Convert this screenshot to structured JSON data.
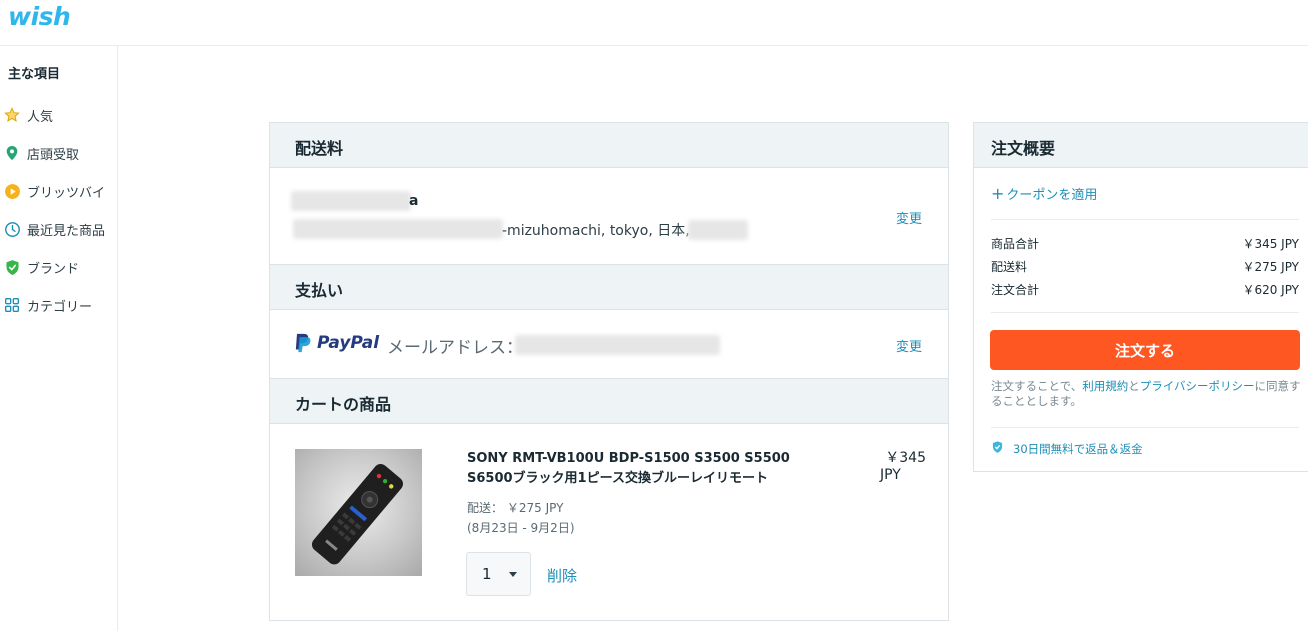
{
  "brand": {
    "logo_text": "wish"
  },
  "sidebar": {
    "heading": "主な項目",
    "items": [
      {
        "label": "人気",
        "icon": "star-icon"
      },
      {
        "label": "店頭受取",
        "icon": "location-pin-icon"
      },
      {
        "label": "ブリッツバイ",
        "icon": "play-circle-icon"
      },
      {
        "label": "最近見た商品",
        "icon": "clock-icon"
      },
      {
        "label": "ブランド",
        "icon": "shield-check-icon"
      },
      {
        "label": "カテゴリー",
        "icon": "grid-icon"
      }
    ]
  },
  "shipping": {
    "title": "配送料",
    "name_visible": "a",
    "address_visible": "-mizuhomachi, tokyo, 日本,",
    "change_label": "変更"
  },
  "payment": {
    "title": "支払い",
    "paypal_brand": "PayPal",
    "email_label": "メールアドレス：",
    "change_label": "変更"
  },
  "cart": {
    "title": "カートの商品",
    "product": {
      "name": "SONY RMT-VB100U BDP-S1500 S3500 S5500 S6500ブラック用1ピース交換ブルーレイリモート",
      "price": "￥345",
      "currency": "JPY",
      "shipping_label": "配送：",
      "shipping_price": "￥275 JPY",
      "delivery_window": "(8月23日 - 9月2日)",
      "quantity": "1",
      "remove_label": "削除"
    }
  },
  "summary": {
    "title": "注文概要",
    "coupon_label": "クーポンを適用",
    "rows": [
      {
        "label": "商品合計",
        "value": "￥345 JPY"
      },
      {
        "label": "配送料",
        "value": "￥275 JPY"
      },
      {
        "label": "注文合計",
        "value": "￥620 JPY"
      }
    ],
    "order_button": "注文する",
    "terms_prefix": "注文することで、",
    "terms_link": "利用規約",
    "terms_and": "と",
    "privacy_link": "プライバシーポリシー",
    "terms_suffix": "に同意することとします。",
    "guarantee": "30日間無料で返品＆返金"
  },
  "colors": {
    "accent": "#1d8fb6",
    "brand": "#2fb7ec",
    "order_button": "#ff5722",
    "section_bg": "#eef3f5"
  }
}
